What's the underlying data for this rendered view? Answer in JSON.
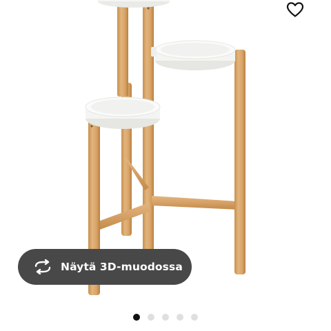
{
  "product_view": {
    "image": "plant-stand-photo",
    "favourite_icon": "heart-outline-icon",
    "view_3d": {
      "icon": "rotate-arrows-icon",
      "label": "Näytä 3D-muodossa"
    },
    "carousel": {
      "total": 5,
      "active_index": 0
    }
  },
  "colors": {
    "bamboo": "#d9a770",
    "tray": "#f3f3f1",
    "pill_background": "#484848",
    "dot_active": "#111111",
    "dot_inactive": "#dfdfdf"
  }
}
